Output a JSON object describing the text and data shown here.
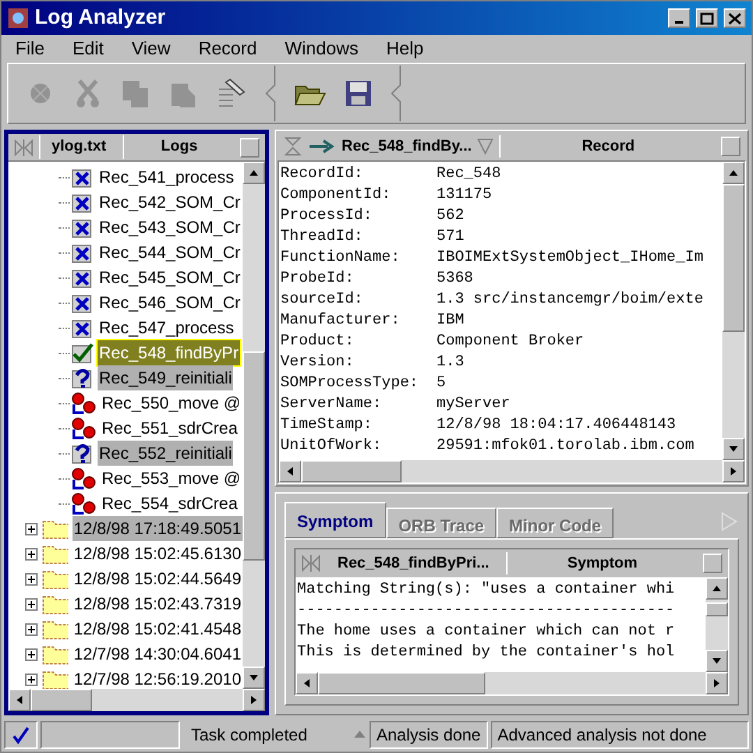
{
  "window": {
    "title": "Log Analyzer"
  },
  "menu": [
    "File",
    "Edit",
    "View",
    "Record",
    "Windows",
    "Help"
  ],
  "toolbar": [
    {
      "kind": "tool",
      "enabled": false
    },
    {
      "kind": "cut",
      "enabled": false
    },
    {
      "kind": "copy",
      "enabled": false
    },
    {
      "kind": "paste",
      "enabled": false
    },
    {
      "kind": "edit",
      "enabled": true
    },
    {
      "kind": "separator"
    },
    {
      "kind": "open",
      "enabled": true
    },
    {
      "kind": "save",
      "enabled": true
    },
    {
      "kind": "separator"
    }
  ],
  "log_panel": {
    "file": "ylog.txt",
    "title": "Logs",
    "items": [
      {
        "kind": "error",
        "label": "Rec_541_process",
        "selected": false,
        "marked": false
      },
      {
        "kind": "error",
        "label": "Rec_542_SOM_Cr",
        "selected": false,
        "marked": false
      },
      {
        "kind": "error",
        "label": "Rec_543_SOM_Cr",
        "selected": false,
        "marked": false
      },
      {
        "kind": "error",
        "label": "Rec_544_SOM_Cr",
        "selected": false,
        "marked": false
      },
      {
        "kind": "error",
        "label": "Rec_545_SOM_Cr",
        "selected": false,
        "marked": false
      },
      {
        "kind": "error",
        "label": "Rec_546_SOM_Cr",
        "selected": false,
        "marked": false
      },
      {
        "kind": "error",
        "label": "Rec_547_process",
        "selected": false,
        "marked": false
      },
      {
        "kind": "ok",
        "label": "Rec_548_findByPr",
        "selected": true,
        "marked": false
      },
      {
        "kind": "unknown",
        "label": "Rec_549_reinitiali",
        "selected": false,
        "marked": true
      },
      {
        "kind": "move",
        "label": "Rec_550_move @",
        "selected": false,
        "marked": false
      },
      {
        "kind": "move",
        "label": "Rec_551_sdrCrea",
        "selected": false,
        "marked": false
      },
      {
        "kind": "unknown",
        "label": "Rec_552_reinitiali",
        "selected": false,
        "marked": true
      },
      {
        "kind": "move",
        "label": "Rec_553_move @",
        "selected": false,
        "marked": false
      },
      {
        "kind": "move",
        "label": "Rec_554_sdrCrea",
        "selected": false,
        "marked": false
      },
      {
        "kind": "folder",
        "label": "12/8/98 17:18:49.5051",
        "selected": false,
        "marked": true,
        "expanded": false
      },
      {
        "kind": "folder",
        "label": "12/8/98 15:02:45.6130",
        "selected": false,
        "marked": false,
        "expanded": false
      },
      {
        "kind": "folder",
        "label": "12/8/98 15:02:44.5649",
        "selected": false,
        "marked": false,
        "expanded": false
      },
      {
        "kind": "folder",
        "label": "12/8/98 15:02:43.7319",
        "selected": false,
        "marked": false,
        "expanded": false
      },
      {
        "kind": "folder",
        "label": "12/8/98 15:02:41.4548",
        "selected": false,
        "marked": false,
        "expanded": false
      },
      {
        "kind": "folder",
        "label": "12/7/98 14:30:04.6041",
        "selected": false,
        "marked": false,
        "expanded": false
      },
      {
        "kind": "folder",
        "label": "12/7/98 12:56:19.2010",
        "selected": false,
        "marked": false,
        "expanded": false
      }
    ]
  },
  "record_panel": {
    "record": "Rec_548_findBy...",
    "title": "Record",
    "fields": [
      {
        "name": "RecordId:",
        "value": "Rec_548"
      },
      {
        "name": "ComponentId:",
        "value": "131175"
      },
      {
        "name": "ProcessId:",
        "value": "562"
      },
      {
        "name": "ThreadId:",
        "value": "571"
      },
      {
        "name": "FunctionName:",
        "value": "IBOIMExtSystemObject_IHome_Im"
      },
      {
        "name": "ProbeId:",
        "value": "5368"
      },
      {
        "name": "sourceId:",
        "value": "1.3 src/instancemgr/boim/exte"
      },
      {
        "name": "Manufacturer:",
        "value": "IBM"
      },
      {
        "name": "Product:",
        "value": "Component Broker"
      },
      {
        "name": "Version:",
        "value": "1.3"
      },
      {
        "name": "SOMProcessType:",
        "value": "5"
      },
      {
        "name": "ServerName:",
        "value": "myServer"
      },
      {
        "name": "TimeStamp:",
        "value": "12/8/98 18:04:17.406448143"
      },
      {
        "name": "UnitOfWork:",
        "value": "29591:mfok01.torolab.ibm.com"
      }
    ]
  },
  "analysis_tabs": [
    {
      "label": "Symptom",
      "selected": true,
      "disabled": false
    },
    {
      "label": "ORB Trace",
      "selected": false,
      "disabled": true
    },
    {
      "label": "Minor Code",
      "selected": false,
      "disabled": true
    }
  ],
  "symptom_panel": {
    "record": "Rec_548_findByPri...",
    "title": "Symptom",
    "lines": [
      "Matching String(s): \"uses a container whi",
      "-----------------------------------------",
      "The home uses a container which can not r",
      "This is determined by the container's hol"
    ]
  },
  "status_bar": {
    "task": "Task completed",
    "analysis": "Analysis done",
    "advanced": "Advanced analysis not done"
  }
}
